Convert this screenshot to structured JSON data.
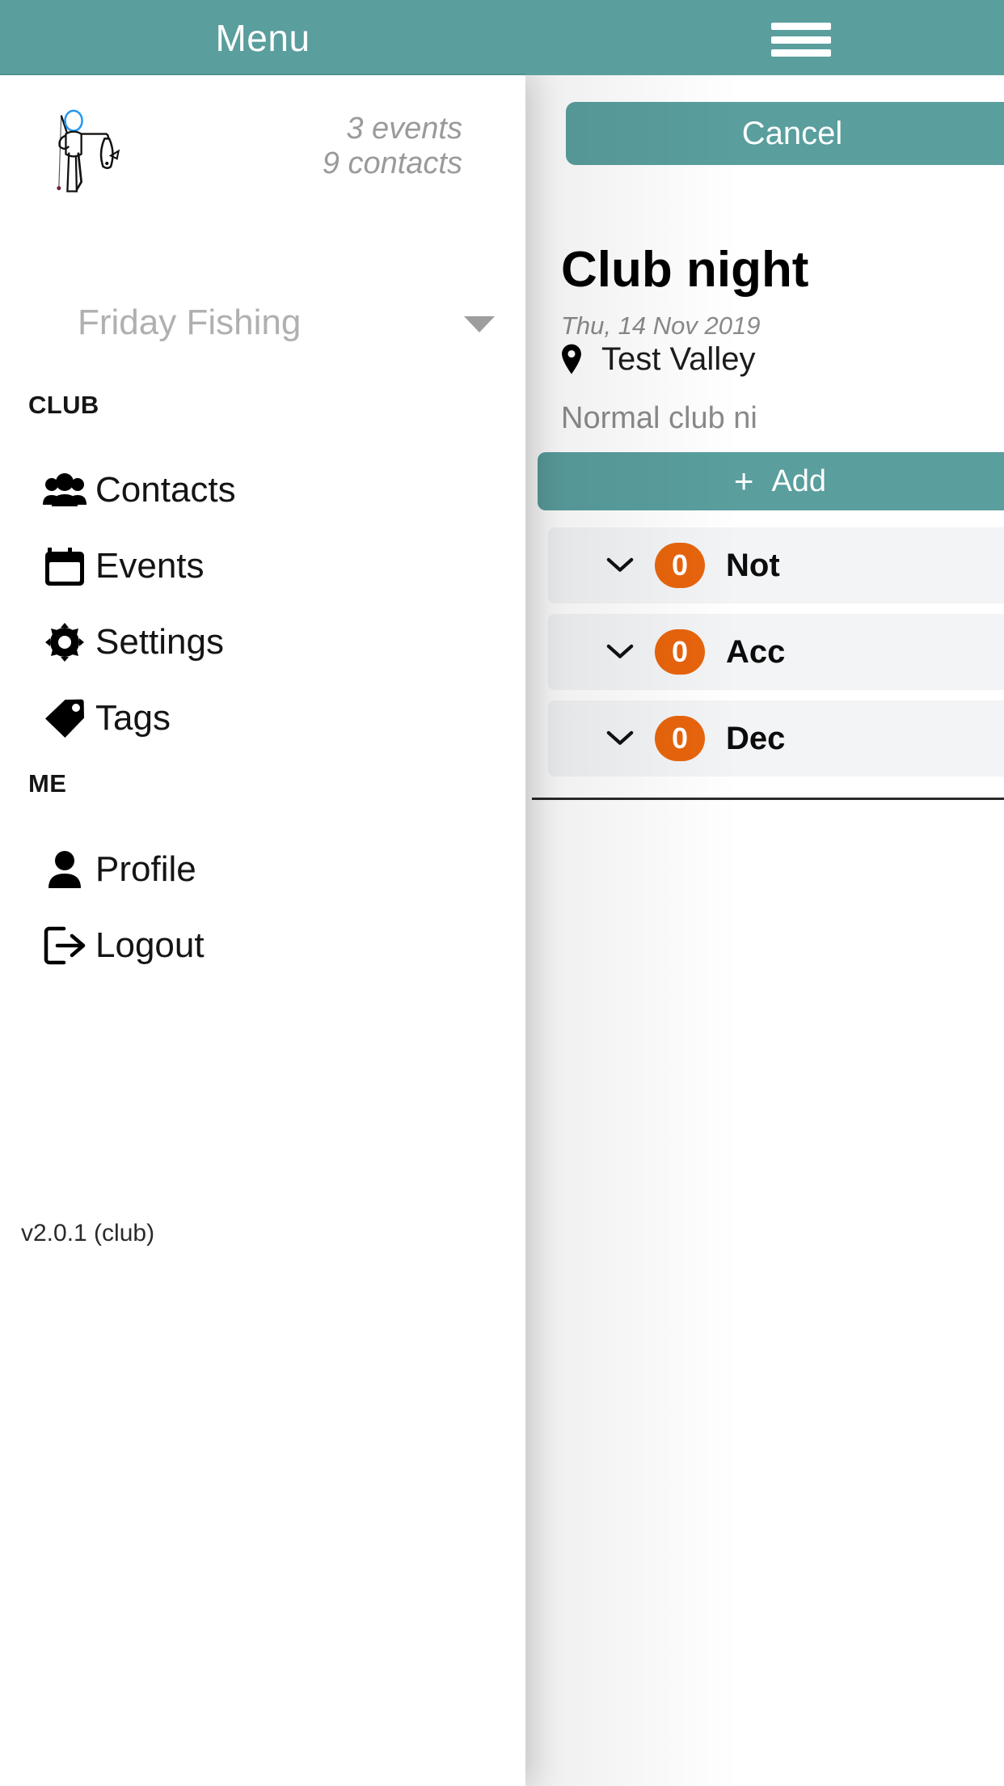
{
  "colors": {
    "teal": "#5a9e9e",
    "orange": "#e8640c",
    "accordion_bg": "#f2f4f6",
    "muted_grey": "#9a9a9a"
  },
  "topbar": {
    "title": "Menu",
    "menu_icon": "hamburger-icon"
  },
  "drawer": {
    "avatar_icon": "fisherman-avatar",
    "stats": {
      "events": "3 events",
      "contacts": "9 contacts"
    },
    "club_selector": {
      "value": "Friday Fishing",
      "caret_icon": "caret-down-icon"
    },
    "sections": [
      {
        "heading": "CLUB",
        "items": [
          {
            "label": "Contacts",
            "icon": "people-group-icon"
          },
          {
            "label": "Events",
            "icon": "calendar-icon"
          },
          {
            "label": "Settings",
            "icon": "gear-icon"
          },
          {
            "label": "Tags",
            "icon": "tag-icon"
          }
        ]
      },
      {
        "heading": "ME",
        "items": [
          {
            "label": "Profile",
            "icon": "person-icon"
          },
          {
            "label": "Logout",
            "icon": "logout-icon"
          }
        ]
      }
    ],
    "version": "v2.0.1 (club)"
  },
  "page": {
    "cancel_label": "Cancel",
    "event": {
      "title": "Club night",
      "date": "Thu, 14 Nov 2019",
      "location": "Test Valley",
      "location_icon": "map-pin-icon",
      "description": "Normal club ni"
    },
    "add_button": {
      "plus": "+",
      "label": "Add"
    },
    "attendance_groups": [
      {
        "count": "0",
        "label": "Not",
        "chevron_icon": "chevron-down-icon"
      },
      {
        "count": "0",
        "label": "Acc",
        "chevron_icon": "chevron-down-icon"
      },
      {
        "count": "0",
        "label": "Dec",
        "chevron_icon": "chevron-down-icon"
      }
    ]
  }
}
